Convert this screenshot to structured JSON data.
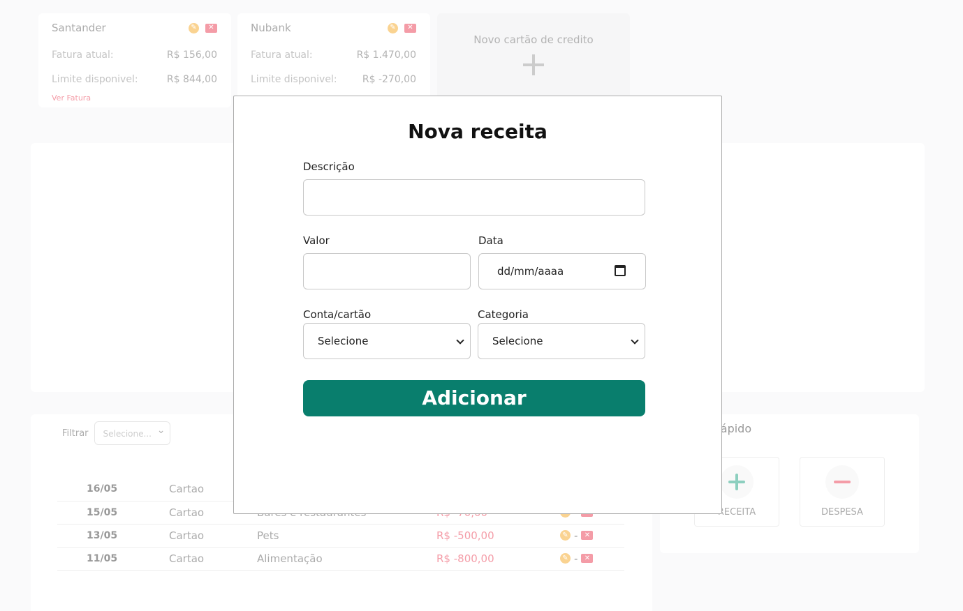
{
  "credit_cards": [
    {
      "name": "Santander",
      "fatura_label": "Fatura atual:",
      "fatura": "R$ 156,00",
      "limite_label": "Limite disponivel:",
      "limite": "R$ 844,00",
      "link": "Ver Fatura"
    },
    {
      "name": "Nubank",
      "fatura_label": "Fatura atual:",
      "fatura": "R$ 1.470,00",
      "limite_label": "Limite disponivel:",
      "limite": "R$ -270,00"
    }
  ],
  "new_card": {
    "label": "Novo cartão de credito"
  },
  "filter": {
    "label": "Filtrar",
    "placeholder": "Selecione..."
  },
  "transactions": [
    {
      "date": "16/05",
      "account": "Cartao",
      "category": "",
      "value": ""
    },
    {
      "date": "15/05",
      "account": "Cartao",
      "category": "Bares e restaurantes",
      "value": "R$ -70,00"
    },
    {
      "date": "13/05",
      "account": "Cartao",
      "category": "Pets",
      "value": "R$ -500,00"
    },
    {
      "date": "11/05",
      "account": "Cartao",
      "category": "Alimentação",
      "value": "R$ -800,00"
    }
  ],
  "action_separator": "-",
  "quick": {
    "title": "Rápido",
    "receita": "RECEITA",
    "despesa": "DESPESA"
  },
  "modal": {
    "title": "Nova receita",
    "descricao_label": "Descrição",
    "descricao_value": "",
    "valor_label": "Valor",
    "valor_value": "",
    "data_label": "Data",
    "data_placeholder": "dd/mm/aaaa",
    "conta_label": "Conta/cartão",
    "conta_value": "Selecione",
    "categoria_label": "Categoria",
    "categoria_value": "Selecione",
    "submit": "Adicionar"
  },
  "colors": {
    "primary": "#097e6d",
    "danger": "#e8384f",
    "edit": "#f5a623"
  }
}
